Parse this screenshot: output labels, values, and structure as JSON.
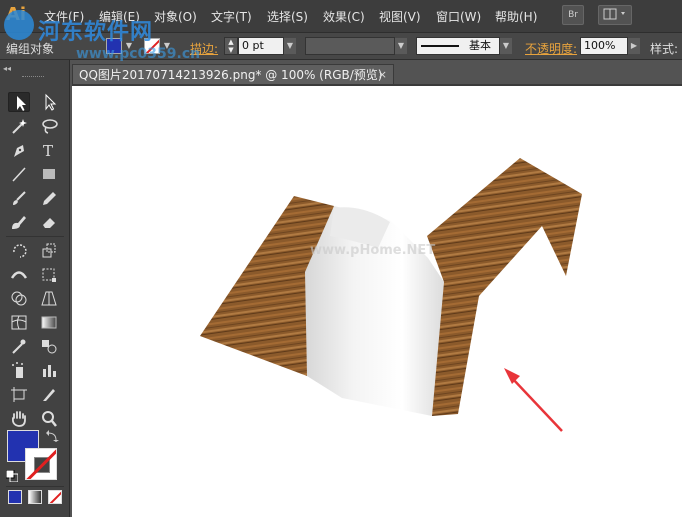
{
  "app": {
    "logo": "Ai"
  },
  "menu": {
    "items": [
      {
        "label": "文件(F)"
      },
      {
        "label": "编辑(E)"
      },
      {
        "label": "对象(O)"
      },
      {
        "label": "文字(T)"
      },
      {
        "label": "选择(S)"
      },
      {
        "label": "效果(C)"
      },
      {
        "label": "视图(V)"
      },
      {
        "label": "窗口(W)"
      },
      {
        "label": "帮助(H)"
      }
    ],
    "bridge_label": "Br"
  },
  "watermark": {
    "name": "河东软件网",
    "url": "www.pc0359.cn",
    "overlay": "www.pHome.NET"
  },
  "controlbar": {
    "object_label": "编组对象",
    "fill_color": "#2232b0",
    "stroke_label": "描边:",
    "stroke_weight": "0 pt",
    "brush_label": "基本",
    "opacity_label": "不透明度:",
    "opacity_value": "100%",
    "style_label": "样式:"
  },
  "document": {
    "tab_title": "QQ图片20170714213926.png* @ 100% (RGB/预览)",
    "close_glyph": "×"
  },
  "toolbar": {
    "collapse_glyph": "◂◂",
    "fill_color": "#2232b0",
    "stroke_color": "#ffffff"
  },
  "colors": {
    "accent": "#e8a33d",
    "arrow": "#e8353a",
    "wood": "#8b5a2b"
  }
}
